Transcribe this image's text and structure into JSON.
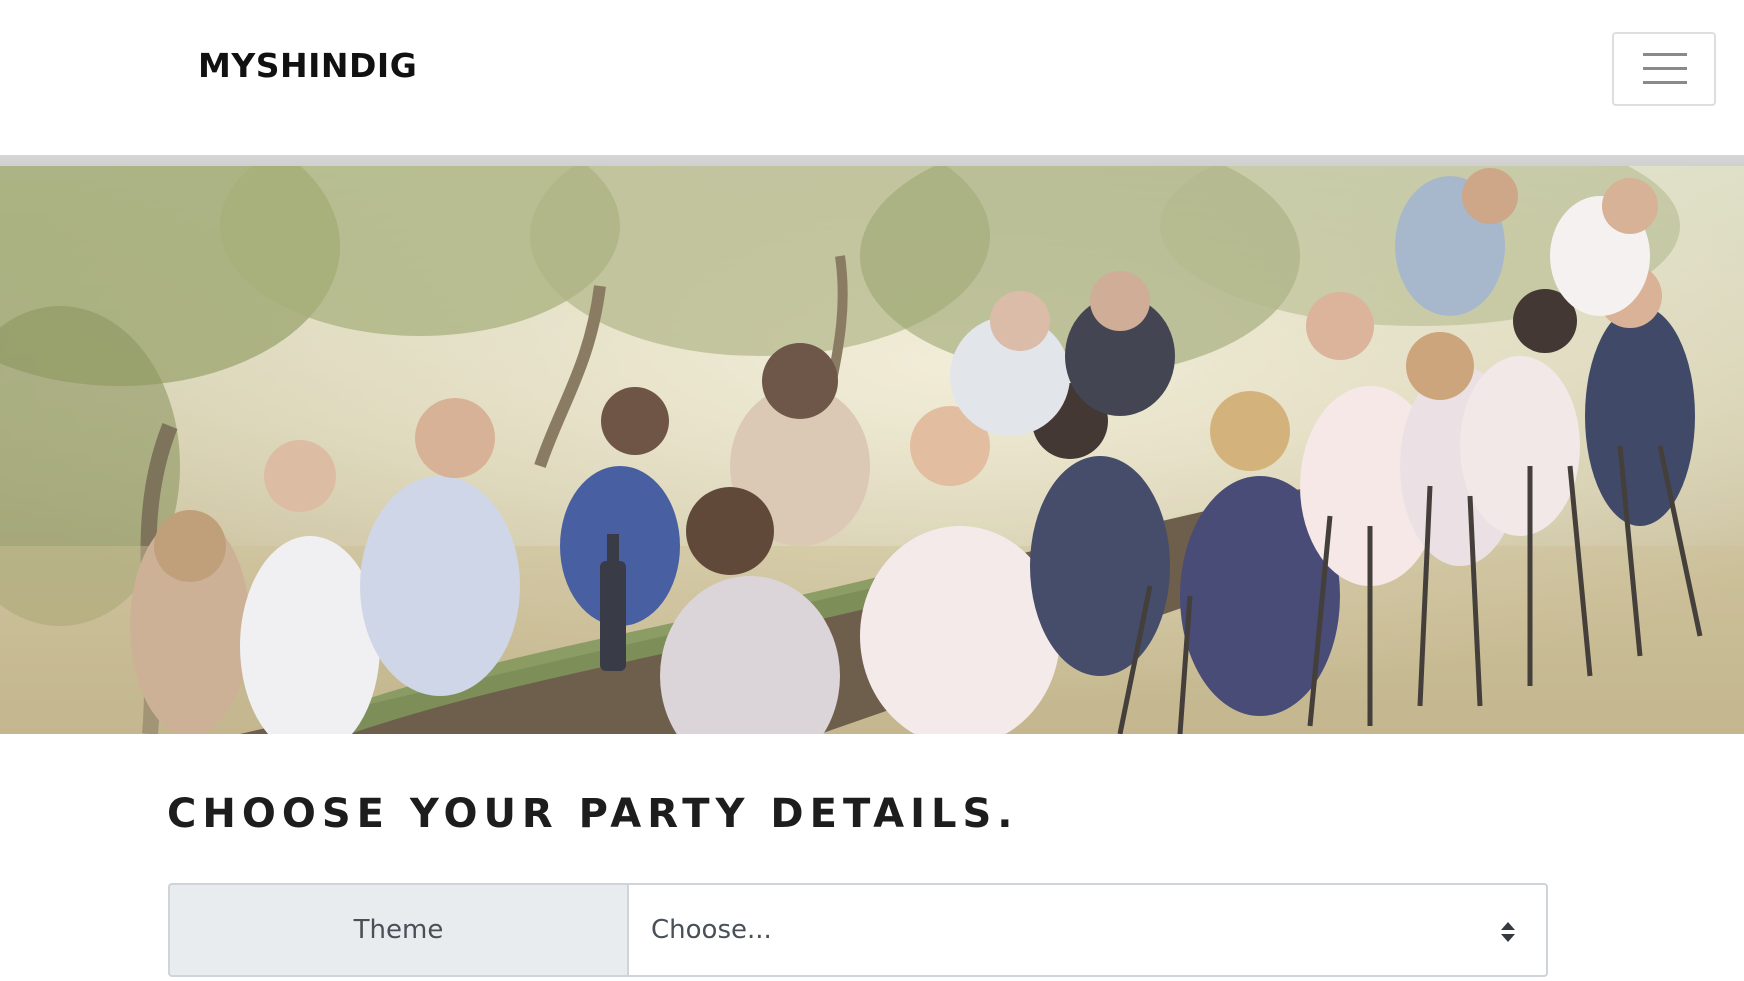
{
  "navbar": {
    "brand": "MYSHINDIG",
    "menu_icon": "hamburger-menu-icon"
  },
  "hero": {
    "image_subject": "outdoor dinner party in an olive grove"
  },
  "form": {
    "title": "CHOOSE YOUR PARTY DETAILS.",
    "theme_label": "Theme",
    "theme_selected": "Choose..."
  },
  "colors": {
    "label_bg": "#e9ecef",
    "border": "#ced4da",
    "text": "#495057"
  }
}
